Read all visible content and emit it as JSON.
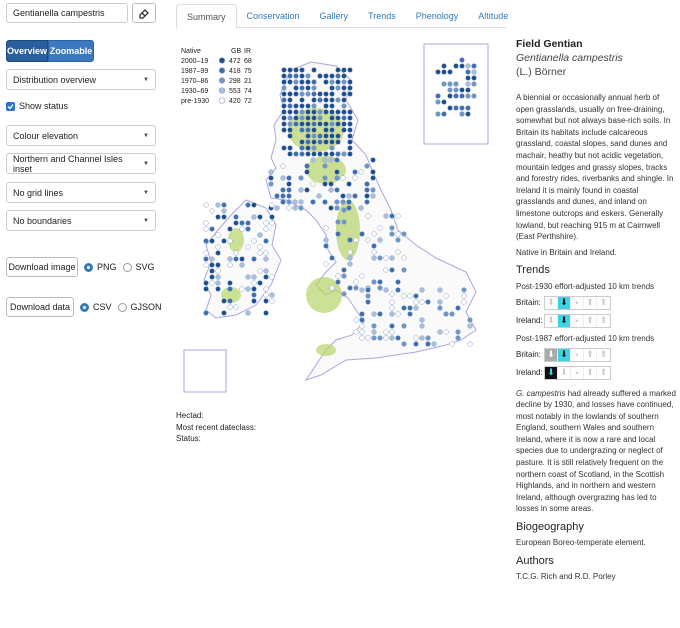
{
  "search": {
    "value": "Gentianella campestris"
  },
  "mode_tabs": {
    "overview": "Overview",
    "zoomable": "Zoomable"
  },
  "selects": {
    "distribution": "Distribution overview",
    "colour": "Colour elevation",
    "inset": "Northern and Channel Isles inset",
    "grid": "No grid lines",
    "boundaries": "No boundaries"
  },
  "show_status": "Show status",
  "download_image": {
    "label": "Download image",
    "opt1": "PNG",
    "opt2": "SVG"
  },
  "download_data": {
    "label": "Download data",
    "opt1": "CSV",
    "opt2": "GJSON"
  },
  "tabs": [
    "Summary",
    "Conservation",
    "Gallery",
    "Trends",
    "Phenology",
    "Altitude"
  ],
  "legend": {
    "head_native": "Native",
    "head_gb": "GB",
    "head_ir": "IR",
    "rows": [
      {
        "label": "2000–19",
        "gb": "472",
        "ir": "68",
        "color": "#1f4e8c"
      },
      {
        "label": "1987–99",
        "gb": "418",
        "ir": "75",
        "color": "#3f6fae"
      },
      {
        "label": "1970–86",
        "gb": "298",
        "ir": "21",
        "color": "#6f95c4"
      },
      {
        "label": "1930–69",
        "gb": "553",
        "ir": "74",
        "color": "#a9bfdc"
      },
      {
        "label": "pre-1930",
        "gb": "420",
        "ir": "72",
        "color": "#ffffff"
      }
    ]
  },
  "map_info": {
    "hectad": "Hectad:",
    "dateclass": "Most recent dateclass:",
    "status": "Status:"
  },
  "species": {
    "common": "Field Gentian",
    "latin": "Gentianella campestris",
    "authority": "(L.) Börner",
    "desc": "A biennial or occasionally annual herb of open grasslands, usually on free-draining, somewhat but not always base-rich soils. In Britain its habitats include calcareous grassland, coastal slopes, sand dunes and machair, heathy but not acidic vegetation, mountain ledges and grassy slopes, tracks and forestry rides, riverbanks and shingle. In Ireland it is mainly found in coastal grasslands and dunes, and inland on limestone outcrops and eskers. Generally lowland, but reaching 915 m at Cairnwell (East Perthshire).",
    "native": "Native in Britain and Ireland."
  },
  "trends": {
    "heading": "Trends",
    "post1930": "Post-1930 effort-adjusted 10 km trends",
    "post1987": "Post-1987 effort-adjusted 10 km trends",
    "britain": "Britain:",
    "ireland": "Ireland:"
  },
  "trend_text_latin": "G. campestris",
  "trend_text": " had already suffered a marked decline by 1930, and losses have continued, most notably in the lowlands of southern England, southern Wales and southern Ireland, where it is now a rare and local species due to undergrazing or neglect of pasture. It is still relatively frequent on the northern coast of Scotland, in the Scottish Highlands, and in northern and western Ireland, although overgrazing has led to losses in some areas.",
  "biogeography": {
    "heading": "Biogeography",
    "text": "European Boreo-temperate element."
  },
  "authors": {
    "heading": "Authors",
    "text": "T.C.G. Rich and R.D. Porley"
  }
}
